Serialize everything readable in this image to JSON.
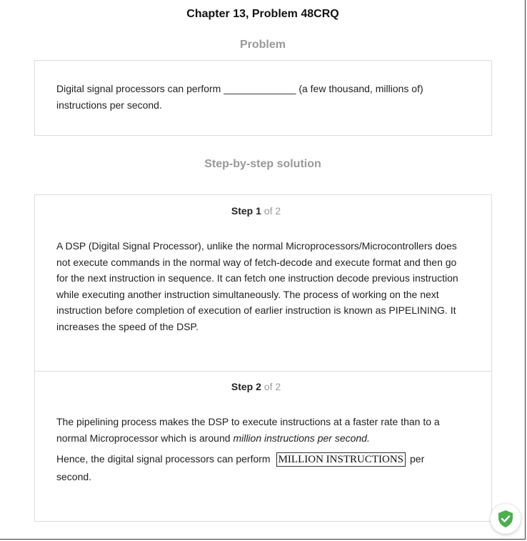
{
  "header": {
    "chapter_title": "Chapter 13, Problem 48CRQ"
  },
  "problem": {
    "heading": "Problem",
    "text": "Digital signal processors can perform _____________ (a few thousand, millions of) instructions per second."
  },
  "solution": {
    "heading": "Step-by-step solution",
    "steps": [
      {
        "word": "Step",
        "number": "1",
        "of": "of 2",
        "text": "A DSP (Digital Signal Processor), unlike the normal Microprocessors/Microcontrollers does not execute commands in the normal way of fetch-decode and execute format and then go for the next instruction in sequence. It can fetch one instruction decode previous instruction while executing another instruction simultaneously. The process of working on the next instruction before completion of execution of earlier instruction is known as PIPELINING. It increases the speed of the DSP."
      },
      {
        "word": "Step",
        "number": "2",
        "of": "of 2",
        "text_before_italic": "The pipelining process makes the DSP to execute instructions at a faster rate than to a normal Microprocessor which is around ",
        "text_italic": "million instructions per second.",
        "answer_prefix": "Hence, the digital signal processors can perform",
        "answer_boxed": "MILLION INSTRUCTIONS",
        "answer_suffix": "per second."
      }
    ]
  },
  "badge": {
    "icon": "shield-check-icon",
    "color": "#4caf50"
  }
}
